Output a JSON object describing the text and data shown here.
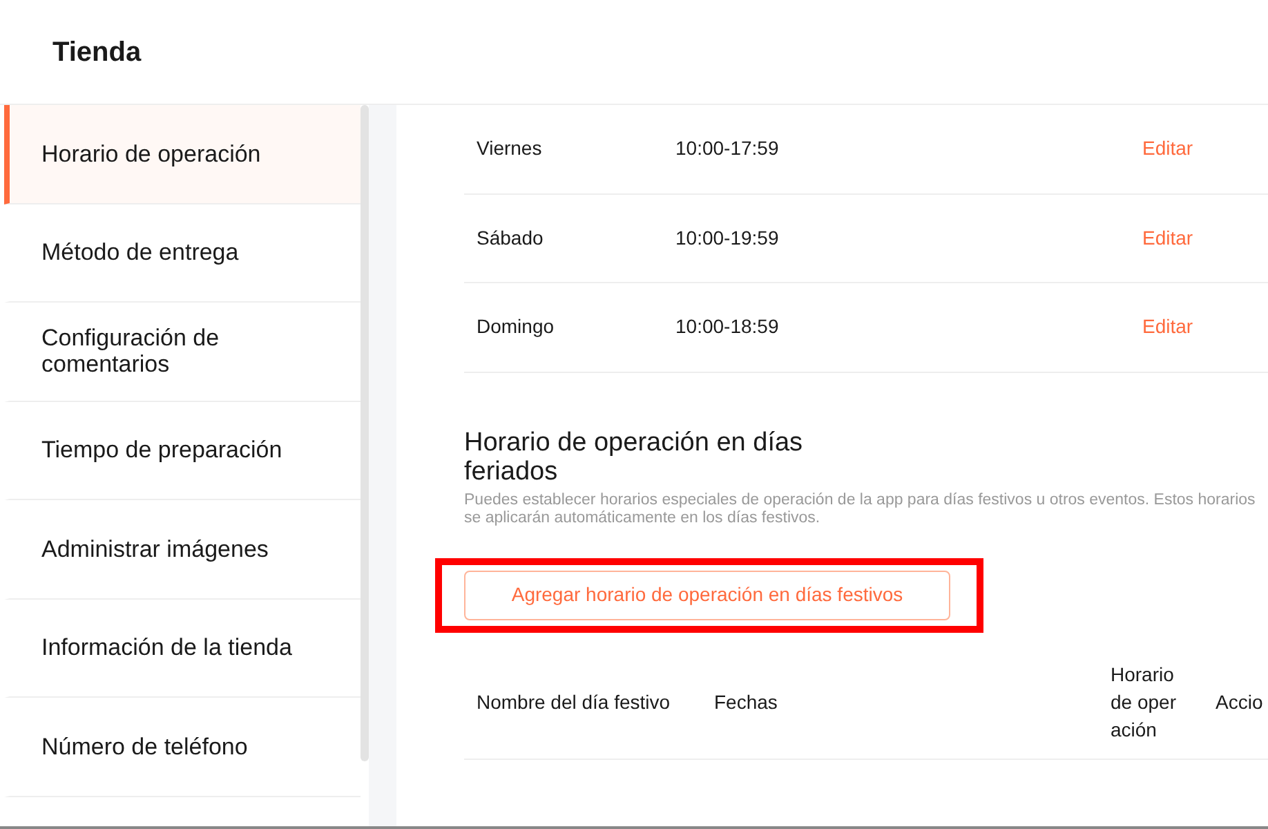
{
  "header": {
    "title": "Tienda"
  },
  "sidebar": {
    "items": [
      {
        "label": "Horario de operación",
        "selected": true
      },
      {
        "label": "Método de entrega",
        "selected": false
      },
      {
        "label": "Configuración de comentarios",
        "selected": false
      },
      {
        "label": "Tiempo de preparación",
        "selected": false
      },
      {
        "label": "Administrar imágenes",
        "selected": false
      },
      {
        "label": "Información de la tienda",
        "selected": false
      },
      {
        "label": "Número de teléfono",
        "selected": false
      }
    ]
  },
  "schedule": {
    "rows": [
      {
        "day": "Viernes",
        "hours": "10:00-17:59",
        "action": "Editar"
      },
      {
        "day": "Sábado",
        "hours": "10:00-19:59",
        "action": "Editar"
      },
      {
        "day": "Domingo",
        "hours": "10:00-18:59",
        "action": "Editar"
      }
    ]
  },
  "holidays": {
    "title": "Horario de operación en días feriados",
    "description": "Puedes establecer horarios especiales de operación de la app para días festivos u otros eventos. Estos horarios se aplicarán automáticamente en los días festivos.",
    "add_button": "Agregar horario de operación en días festivos",
    "highlighted": true,
    "table": {
      "columns": [
        "Nombre del día festivo",
        "Fechas",
        "Horario de operación",
        "Accio"
      ]
    }
  }
}
